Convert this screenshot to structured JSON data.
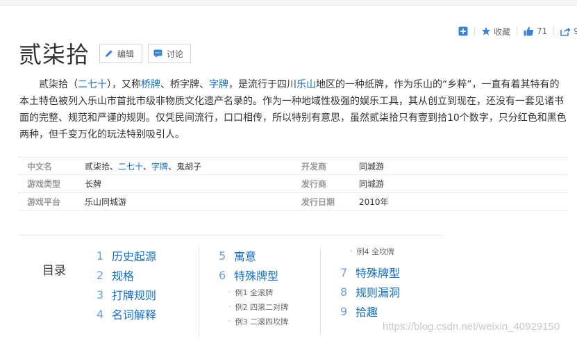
{
  "toolbar": {
    "favorite_label": "收藏",
    "like_count": "71",
    "share_count": "9"
  },
  "title": "贰柒拾",
  "buttons": {
    "edit": "编辑",
    "discuss": "讨论"
  },
  "summary": {
    "p1": "贰柒拾（",
    "link1": "二七十",
    "p2": "），又称",
    "link2": "桥牌",
    "p3": "、桥字牌、",
    "link3": "字牌",
    "p4": "，是流行于四川",
    "link4": "乐山",
    "p5": "地区的一种纸牌，作为乐山的“乡粹”，一直有着其特有的本土特色被列入乐山市首批市级非物质文化遗产名录的。作为一种地域性极强的娱乐工具，其从创立到现在，还没有一套见诸书面的完整、规范和严谨的规则。仅凭民间流行，口口相传，所以特别有意思，虽然贰柒拾只有壹到拾10个数字，只分红色和黑色两种，但千变万化的玩法特别吸引人。"
  },
  "basic_info": {
    "row1": {
      "k1": "中文名",
      "v1a": "贰柒拾、",
      "v1b": "二七十",
      "v1c": "、",
      "v1d": "字牌",
      "v1e": "、鬼胡子",
      "k2": "开发商",
      "v2": "同城游"
    },
    "row2": {
      "k1": "游戏类型",
      "v1": "长牌",
      "k2": "发行商",
      "v2": "同城游"
    },
    "row3": {
      "k1": "游戏平台",
      "v1": "乐山同城游",
      "k2": "发行日期",
      "v2": "2010年"
    }
  },
  "catalog": {
    "title": "目录",
    "col1": [
      {
        "num": "1",
        "label": "历史起源"
      },
      {
        "num": "2",
        "label": "规格"
      },
      {
        "num": "3",
        "label": "打牌规则"
      },
      {
        "num": "4",
        "label": "名词解释"
      }
    ],
    "col2": {
      "items": [
        {
          "num": "5",
          "label": "寓意"
        },
        {
          "num": "6",
          "label": "特殊牌型"
        }
      ],
      "subs": [
        "例1 全滚牌",
        "例2 四滚二对牌",
        "例3 二滚四坎牌"
      ]
    },
    "col3": {
      "sub": "例4 全坎牌",
      "items": [
        {
          "num": "7",
          "label": "特殊牌型"
        },
        {
          "num": "8",
          "label": "规则漏洞"
        },
        {
          "num": "9",
          "label": "拾趣"
        }
      ]
    }
  },
  "watermark": "https://blog.csdn.net/weixin_40929150"
}
